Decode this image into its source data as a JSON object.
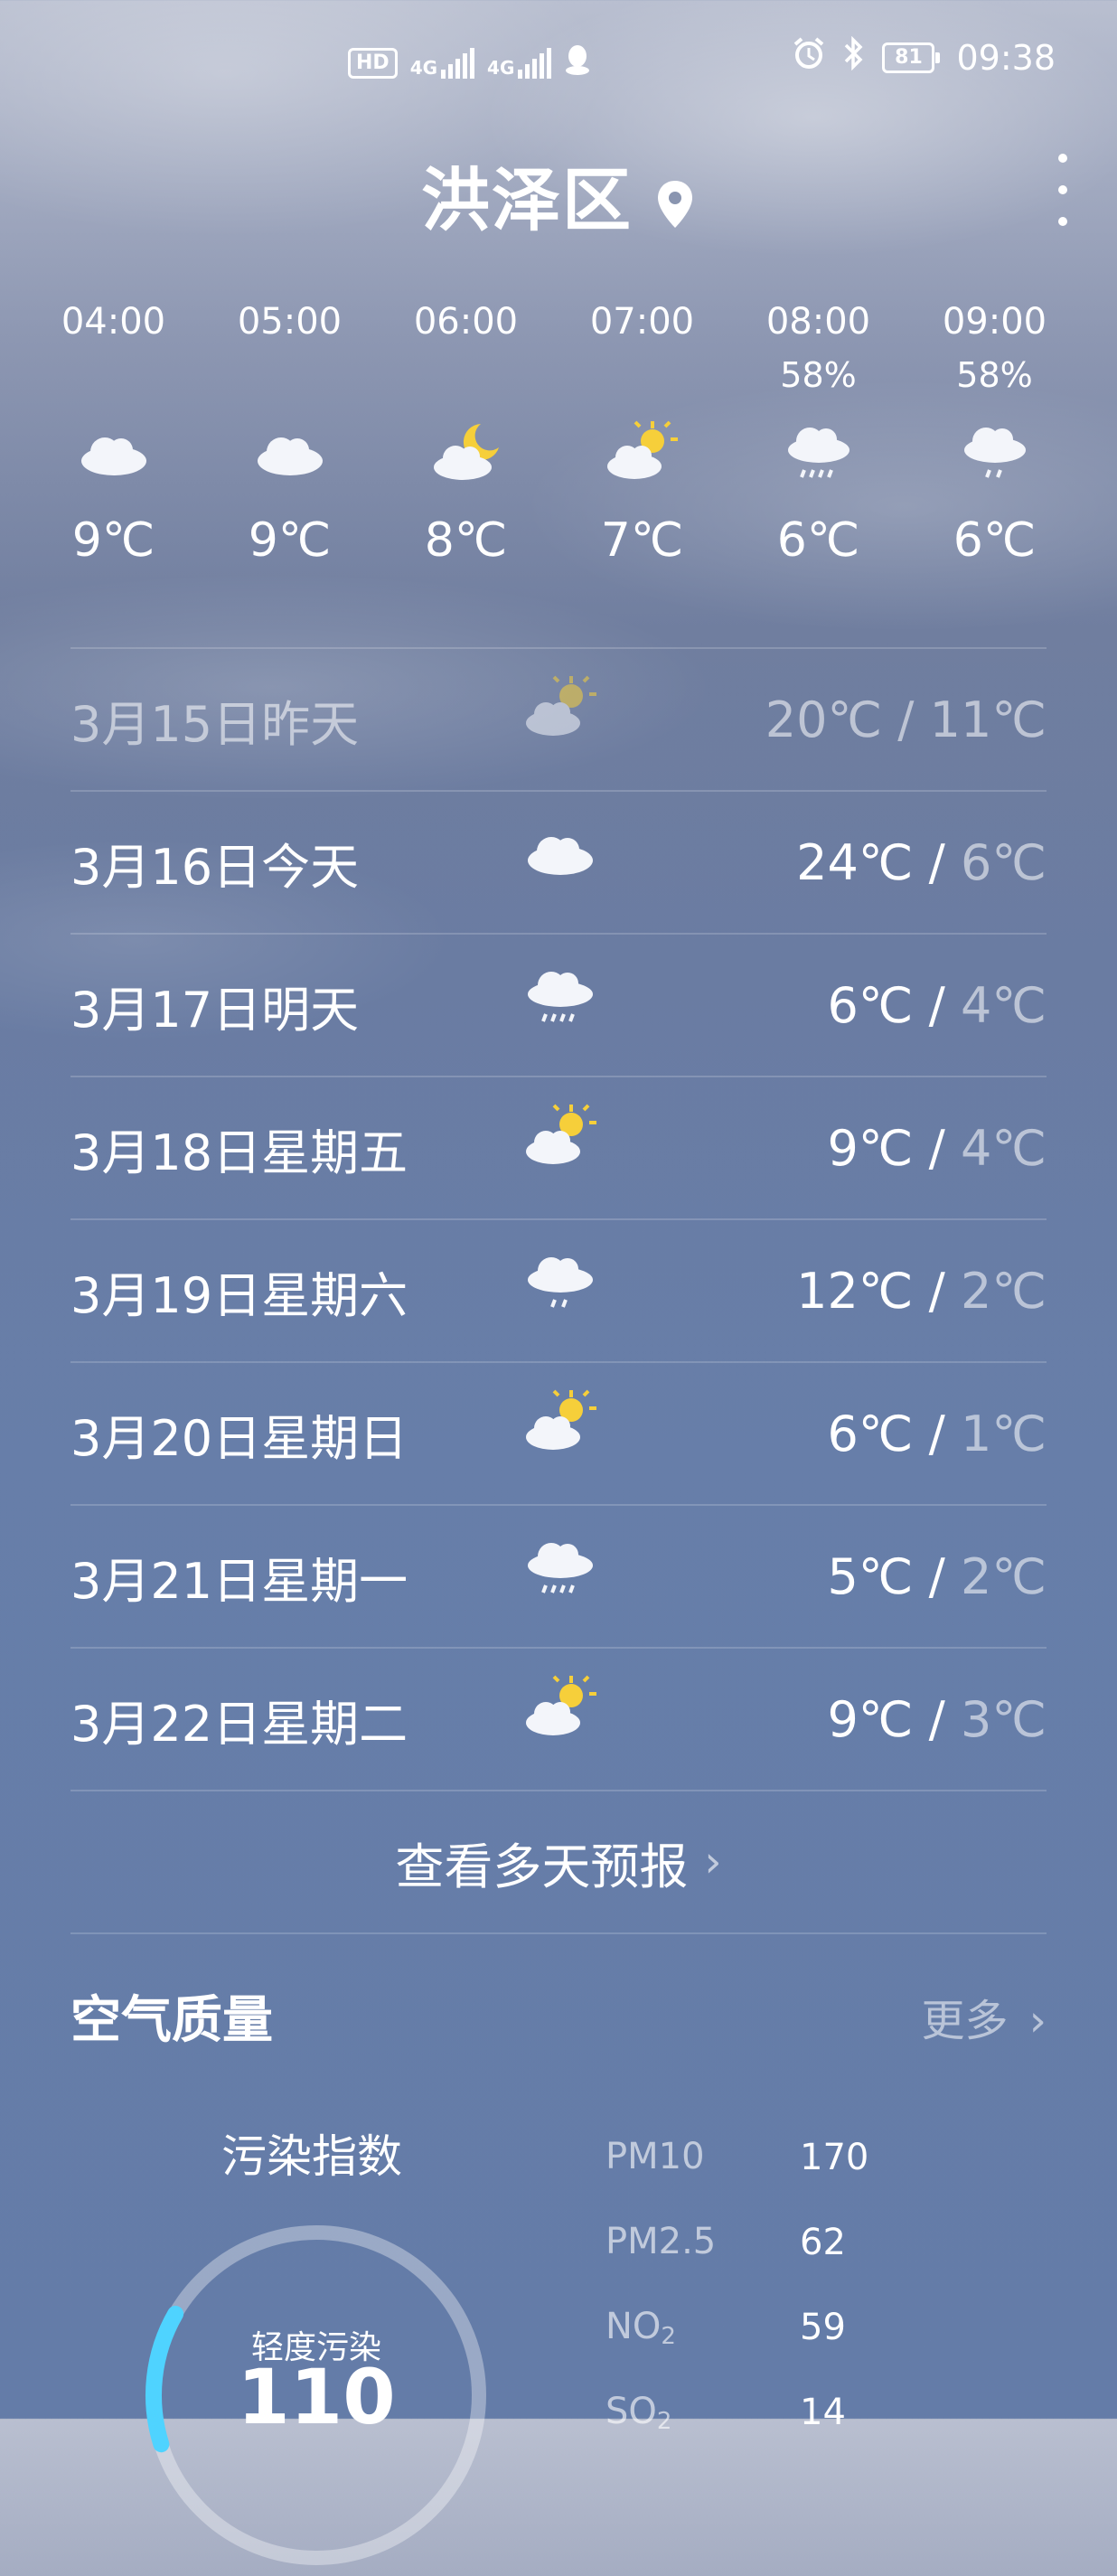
{
  "status_bar": {
    "left_icons": [
      "hd-icon",
      "signal-4g-icon",
      "signal-4g-icon",
      "qq-icon"
    ],
    "hd_label": "HD",
    "net_label": "4G",
    "net2_label": "4G",
    "battery": "81",
    "time": "09:38"
  },
  "header": {
    "location": "洪泽区"
  },
  "hourly": [
    {
      "time": "04:00",
      "precip": "",
      "icon": "cloudy-icon",
      "temp": "9℃"
    },
    {
      "time": "05:00",
      "precip": "",
      "icon": "cloudy-icon",
      "temp": "9℃"
    },
    {
      "time": "06:00",
      "precip": "",
      "icon": "moon-cloud-icon",
      "temp": "8℃"
    },
    {
      "time": "07:00",
      "precip": "",
      "icon": "partly-sunny-icon",
      "temp": "7℃"
    },
    {
      "time": "08:00",
      "precip": "58%",
      "icon": "rain-icon",
      "temp": "6℃"
    },
    {
      "time": "09:00",
      "precip": "58%",
      "icon": "light-rain-icon",
      "temp": "6℃"
    }
  ],
  "daily": [
    {
      "date": "3月15日昨天",
      "icon": "partly-sunny-icon",
      "high": "20℃",
      "low": "11℃"
    },
    {
      "date": "3月16日今天",
      "icon": "cloudy-icon",
      "high": "24℃",
      "low": "6℃"
    },
    {
      "date": "3月17日明天",
      "icon": "rain-icon",
      "high": "6℃",
      "low": "4℃"
    },
    {
      "date": "3月18日星期五",
      "icon": "partly-sunny-icon",
      "high": "9℃",
      "low": "4℃"
    },
    {
      "date": "3月19日星期六",
      "icon": "light-rain-icon",
      "high": "12℃",
      "low": "2℃"
    },
    {
      "date": "3月20日星期日",
      "icon": "partly-sunny-icon",
      "high": "6℃",
      "low": "1℃"
    },
    {
      "date": "3月21日星期一",
      "icon": "rain-icon",
      "high": "5℃",
      "low": "2℃"
    },
    {
      "date": "3月22日星期二",
      "icon": "partly-sunny-icon",
      "high": "9℃",
      "low": "3℃"
    }
  ],
  "more_forecast": "查看多天预报",
  "air_quality": {
    "title": "空气质量",
    "more": "更多",
    "index_label": "污染指数",
    "status": "轻度污染",
    "value": "110",
    "value_num": 110,
    "gauge_max": 500,
    "pollutants": [
      {
        "name": "PM10",
        "sub": "",
        "value": "170"
      },
      {
        "name": "PM2.5",
        "sub": "",
        "value": "62"
      },
      {
        "name": "NO",
        "sub": "2",
        "value": "59"
      },
      {
        "name": "SO",
        "sub": "2",
        "value": "14"
      }
    ],
    "accent_color": "#4fd3ff"
  }
}
